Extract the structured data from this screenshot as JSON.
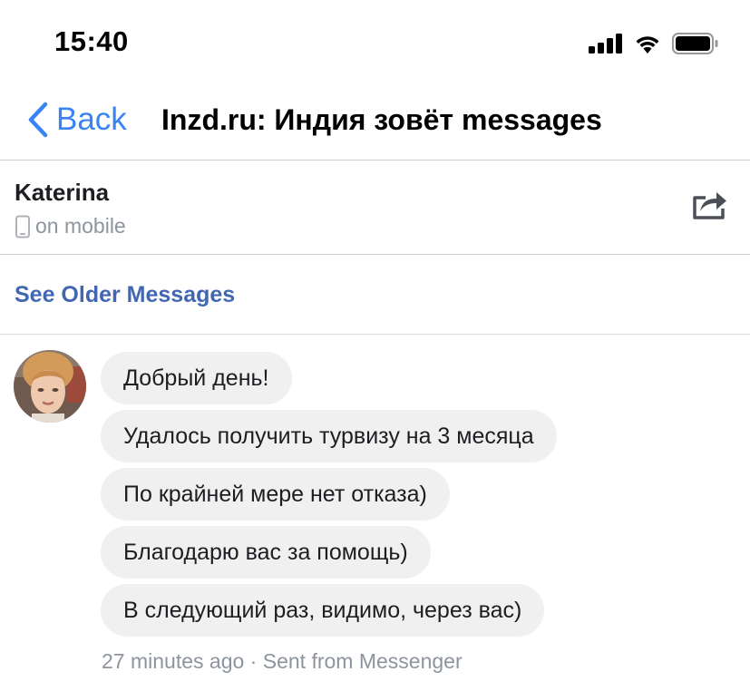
{
  "status_bar": {
    "time": "15:40",
    "icons": [
      "cellular-signal-icon",
      "wifi-icon",
      "battery-icon"
    ]
  },
  "nav": {
    "back_label": "Back",
    "title": "Inzd.ru: Индия зовёт messages"
  },
  "contact": {
    "name": "Katerina",
    "status": "on mobile"
  },
  "older_link": "See Older Messages",
  "messages": [
    "Добрый день!",
    "Удалось получить турвизу на 3 месяца",
    "По крайней мере нет отказа)",
    "Благодарю вас за помощь)",
    "В следующий раз, видимо, через вас)"
  ],
  "meta": {
    "age": "27 minutes ago",
    "separator": " · ",
    "source": "Sent from Messenger"
  },
  "colors": {
    "accent": "#3b83f4",
    "link": "#4267b2",
    "bubble": "#f0f0f0",
    "muted": "#8d949e"
  }
}
